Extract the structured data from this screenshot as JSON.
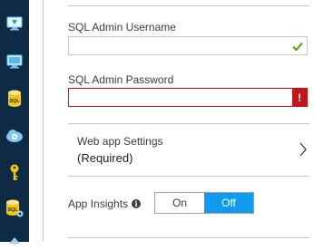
{
  "sidebar": {
    "icons": [
      {
        "name": "monitor-icon"
      },
      {
        "name": "screen-icon"
      },
      {
        "name": "sql-database-icon",
        "text": "SQL"
      },
      {
        "name": "cloud-gear-icon"
      },
      {
        "name": "key-icon"
      },
      {
        "name": "sql-settings-icon",
        "text": "SQL"
      },
      {
        "name": "up-arrow-icon"
      }
    ]
  },
  "form": {
    "username_label": "SQL Admin Username",
    "username_value": "",
    "password_label": "SQL Admin Password",
    "password_value": "",
    "password_error_mark": "!",
    "webapp_title": "Web app Settings",
    "webapp_subtitle": "(Required)",
    "insights_label": "App Insights",
    "info_mark": "i",
    "toggle_on": "On",
    "toggle_off": "Off",
    "toggle_selected": "Off"
  },
  "colors": {
    "rail": "#0e2a44",
    "accent": "#0f9bf0",
    "error": "#c4131b",
    "success": "#57a300"
  }
}
